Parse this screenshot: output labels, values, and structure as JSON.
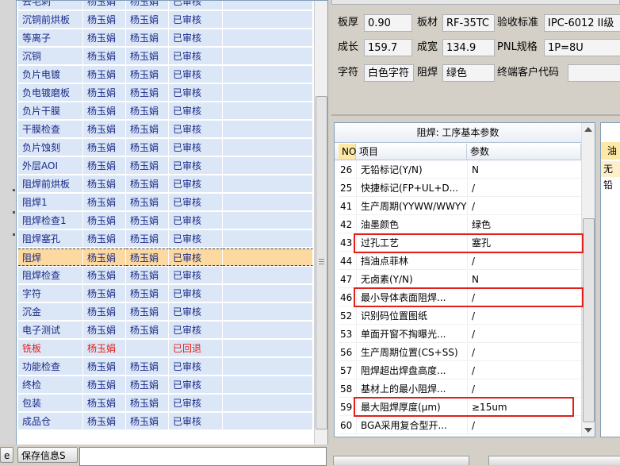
{
  "process_grid": {
    "rows": [
      {
        "name": "去毛刺",
        "p1": "杨玉娟",
        "p2": "杨玉娟",
        "status": "已审核",
        "state": "normal"
      },
      {
        "name": "沉铜前烘板",
        "p1": "杨玉娟",
        "p2": "杨玉娟",
        "status": "已审核",
        "state": "normal"
      },
      {
        "name": "等离子",
        "p1": "杨玉娟",
        "p2": "杨玉娟",
        "status": "已审核",
        "state": "normal"
      },
      {
        "name": "沉铜",
        "p1": "杨玉娟",
        "p2": "杨玉娟",
        "status": "已审核",
        "state": "normal"
      },
      {
        "name": "负片电镀",
        "p1": "杨玉娟",
        "p2": "杨玉娟",
        "status": "已审核",
        "state": "normal"
      },
      {
        "name": "负电镀磨板",
        "p1": "杨玉娟",
        "p2": "杨玉娟",
        "status": "已审核",
        "state": "normal"
      },
      {
        "name": "负片干膜",
        "p1": "杨玉娟",
        "p2": "杨玉娟",
        "status": "已审核",
        "state": "normal"
      },
      {
        "name": "干膜检查",
        "p1": "杨玉娟",
        "p2": "杨玉娟",
        "status": "已审核",
        "state": "normal"
      },
      {
        "name": "负片蚀刻",
        "p1": "杨玉娟",
        "p2": "杨玉娟",
        "status": "已审核",
        "state": "normal"
      },
      {
        "name": "外层AOI",
        "p1": "杨玉娟",
        "p2": "杨玉娟",
        "status": "已审核",
        "state": "normal"
      },
      {
        "name": "阻焊前烘板",
        "p1": "杨玉娟",
        "p2": "杨玉娟",
        "status": "已审核",
        "state": "normal"
      },
      {
        "name": "阻焊1",
        "p1": "杨玉娟",
        "p2": "杨玉娟",
        "status": "已审核",
        "state": "normal"
      },
      {
        "name": "阻焊检查1",
        "p1": "杨玉娟",
        "p2": "杨玉娟",
        "status": "已审核",
        "state": "normal"
      },
      {
        "name": "阻焊塞孔",
        "p1": "杨玉娟",
        "p2": "杨玉娟",
        "status": "已审核",
        "state": "normal"
      },
      {
        "name": "阻焊",
        "p1": "杨玉娟",
        "p2": "杨玉娟",
        "status": "已审核",
        "state": "selected"
      },
      {
        "name": "阻焊检查",
        "p1": "杨玉娟",
        "p2": "杨玉娟",
        "status": "已审核",
        "state": "normal"
      },
      {
        "name": "字符",
        "p1": "杨玉娟",
        "p2": "杨玉娟",
        "status": "已审核",
        "state": "normal"
      },
      {
        "name": "沉金",
        "p1": "杨玉娟",
        "p2": "杨玉娟",
        "status": "已审核",
        "state": "normal"
      },
      {
        "name": "电子测试",
        "p1": "杨玉娟",
        "p2": "杨玉娟",
        "status": "已审核",
        "state": "normal"
      },
      {
        "name": "铣板",
        "p1": "杨玉娟",
        "p2": "",
        "status": "已回退",
        "state": "returned"
      },
      {
        "name": "功能检查",
        "p1": "杨玉娟",
        "p2": "杨玉娟",
        "status": "已审核",
        "state": "normal"
      },
      {
        "name": "终检",
        "p1": "杨玉娟",
        "p2": "杨玉娟",
        "status": "已审核",
        "state": "normal"
      },
      {
        "name": "包装",
        "p1": "杨玉娟",
        "p2": "杨玉娟",
        "status": "已审核",
        "state": "normal"
      },
      {
        "name": "成品仓",
        "p1": "杨玉娟",
        "p2": "杨玉娟",
        "status": "已审核",
        "state": "normal"
      }
    ]
  },
  "bottom_left": {
    "left_button": "e",
    "save_button": "保存信息S"
  },
  "board_info": {
    "thickness_label": "板厚",
    "thickness_value": "0.90",
    "material_label": "板材",
    "material_value": "RF-35TC",
    "standard_label": "验收标准",
    "standard_value": "IPC-6012 II级",
    "length_label": "成长",
    "length_value": "159.7",
    "width_label": "成宽",
    "width_value": "134.9",
    "pnl_label": "PNL规格",
    "pnl_value": "1P=8U",
    "char_label": "字符",
    "char_value": "白色字符",
    "mask_label": "阻焊",
    "mask_value": "绿色",
    "customer_code_label": "终端客户代码",
    "customer_code_value": ""
  },
  "param_panel": {
    "title": "阻焊: 工序基本参数",
    "col_no": "NO",
    "col_item": "项目",
    "col_param": "参数",
    "rows": [
      {
        "no": "26",
        "item": "无铅标记(Y/N)",
        "param": "N"
      },
      {
        "no": "25",
        "item": "快捷标记(FP+UL+D...",
        "param": "/"
      },
      {
        "no": "41",
        "item": "生产周期(YYWW/WWYY)",
        "param": "/"
      },
      {
        "no": "42",
        "item": "油墨颜色",
        "param": "绿色"
      },
      {
        "no": "43",
        "item": "过孔工艺",
        "param": "塞孔"
      },
      {
        "no": "44",
        "item": "挡油点菲林",
        "param": "/"
      },
      {
        "no": "47",
        "item": "无卤素(Y/N)",
        "param": "N"
      },
      {
        "no": "46",
        "item": "最小导体表面阻焊...",
        "param": "/"
      },
      {
        "no": "52",
        "item": "识别码位置图纸",
        "param": "/"
      },
      {
        "no": "53",
        "item": "单面开窗不掏曝光...",
        "param": "/"
      },
      {
        "no": "56",
        "item": "生产周期位置(CS+SS)",
        "param": "/"
      },
      {
        "no": "57",
        "item": "阻焊超出焊盘高度...",
        "param": "/"
      },
      {
        "no": "58",
        "item": "基材上的最小阻焊...",
        "param": "/"
      },
      {
        "no": "59",
        "item": "最大阻焊厚度(μm)",
        "param": "≥15um"
      },
      {
        "no": "60",
        "item": "BGA采用复合型开...",
        "param": "/"
      }
    ]
  },
  "right_edge": {
    "header": "油",
    "row1": "无铅"
  },
  "colors": {
    "grid_cell": "#dbe7f7",
    "grid_text": "#1b2a88",
    "selected_row": "#fbd9a0",
    "returned_text": "#e0201a",
    "highlight_box": "#e0201a",
    "no_header": "#fde9a6"
  }
}
